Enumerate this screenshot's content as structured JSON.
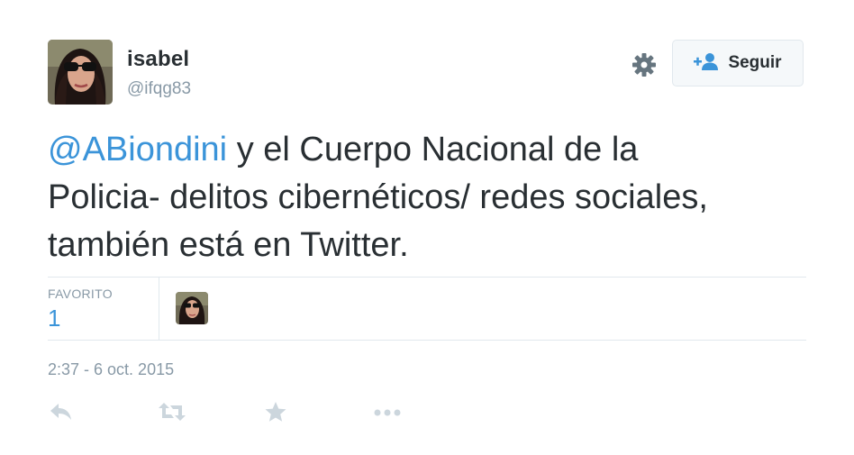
{
  "user": {
    "name": "isabel",
    "handle": "@ifqg83"
  },
  "follow_button": {
    "label": "Seguir",
    "icon": "add-user-icon"
  },
  "settings": {
    "icon": "gear-icon"
  },
  "tweet": {
    "mention": "@ABiondini",
    "text_line1": " y el Cuerpo Nacional de la",
    "text_line2": "Policia- delitos cibernéticos/ redes sociales,",
    "text_line3": "también está en Twitter."
  },
  "stats": {
    "label": "FAVORITO",
    "count": "1"
  },
  "timestamp": "2:37 - 6 oct. 2015",
  "actions": {
    "reply_icon": "reply-icon",
    "retweet_icon": "retweet-icon",
    "favorite_icon": "star-icon",
    "more_icon": "more-icon"
  },
  "colors": {
    "text": "#292f33",
    "muted": "#8899a6",
    "link": "#3b94d9",
    "action_icon": "#ccd6dd",
    "border": "#e1e8ed"
  }
}
